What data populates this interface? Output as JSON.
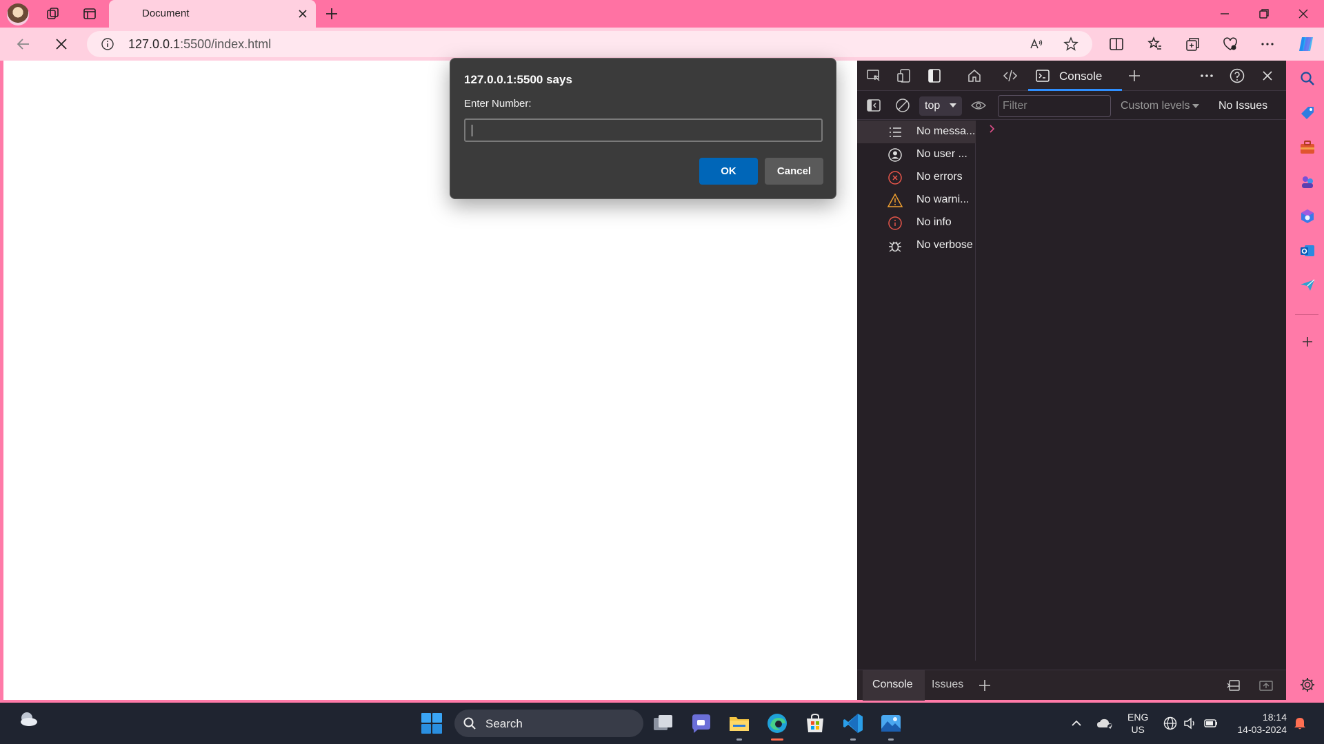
{
  "browser": {
    "tab_title": "Document",
    "url_host": "127.0.0.1",
    "url_rest": ":5500/index.html"
  },
  "dialog": {
    "title": "127.0.0.1:5500 says",
    "message": "Enter Number:",
    "input_value": "",
    "ok_label": "OK",
    "cancel_label": "Cancel"
  },
  "devtools": {
    "console_tab": "Console",
    "context": "top",
    "filter_placeholder": "Filter",
    "levels_label": "Custom levels",
    "issues_label": "No Issues",
    "sidebar": [
      {
        "label": "No messa...",
        "icon": "list-icon"
      },
      {
        "label": "No user ...",
        "icon": "user-icon"
      },
      {
        "label": "No errors",
        "icon": "error-icon"
      },
      {
        "label": "No warni...",
        "icon": "warning-icon"
      },
      {
        "label": "No info",
        "icon": "info-icon"
      },
      {
        "label": "No verbose",
        "icon": "bug-icon"
      }
    ],
    "drawer": {
      "console_tab": "Console",
      "issues_tab": "Issues"
    }
  },
  "taskbar": {
    "search_label": "Search",
    "lang_line1": "ENG",
    "lang_line2": "US",
    "time": "18:14",
    "date": "14-03-2024"
  },
  "colors": {
    "chrome_pink": "#ff72a3",
    "toolbar_pink": "#ffd0e0",
    "dialog_bg": "#3b3b3b",
    "ok_blue": "#0066b8",
    "devtools_bg": "#262026",
    "console_accent": "#2f8fff"
  }
}
